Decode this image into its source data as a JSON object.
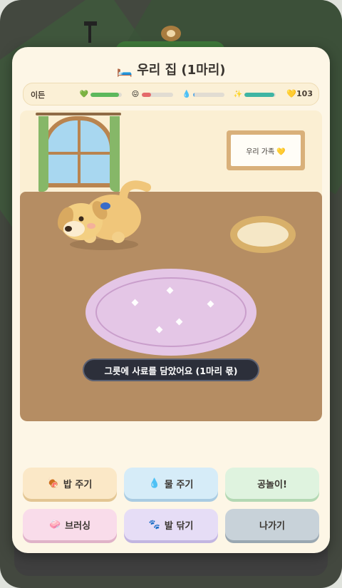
{
  "modal": {
    "title_icon": "bed-icon",
    "title": "우리 집 (1마리)"
  },
  "stats": {
    "pet_name": "이든",
    "items": [
      {
        "name": "health",
        "icon": "💚",
        "value": 0.9,
        "color": "#5cb85c"
      },
      {
        "name": "mood",
        "icon": "😖",
        "value": 0.3,
        "color": "#e46a6a"
      },
      {
        "name": "thirst",
        "icon": "💧",
        "value": 0.05,
        "color": "#5aa9e6"
      },
      {
        "name": "clean",
        "icon": "✨",
        "value": 0.95,
        "color": "#3fb5a3"
      }
    ],
    "coins_icon": "💛",
    "coins": "103"
  },
  "room": {
    "frame_text": "우리 가족 💛"
  },
  "toast": "그릇에 사료를 담았어요 (1마리 몫)",
  "actions": {
    "feed": {
      "icon": "🍖",
      "label": "밥 주기"
    },
    "water": {
      "icon": "💧",
      "label": "물 주기"
    },
    "play": {
      "label": "공놀이!"
    },
    "brush": {
      "icon": "🧼",
      "label": "브러싱"
    },
    "paw": {
      "icon": "🐾",
      "label": "발 닦기"
    },
    "exit": {
      "label": "나가기"
    }
  },
  "colors": {
    "modal_bg": "#fdf6e6",
    "floor": "#b58d63",
    "rug": "#e4c6e6",
    "toast_bg": "#2c2f3a"
  }
}
